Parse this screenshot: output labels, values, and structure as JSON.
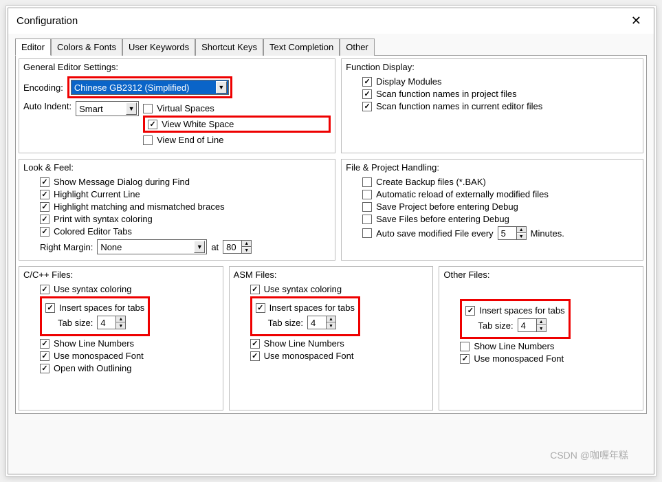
{
  "window": {
    "title": "Configuration",
    "close": "✕"
  },
  "tabs": [
    "Editor",
    "Colors & Fonts",
    "User Keywords",
    "Shortcut Keys",
    "Text Completion",
    "Other"
  ],
  "general": {
    "title": "General Editor Settings:",
    "encoding_label": "Encoding:",
    "encoding_value": "Chinese GB2312 (Simplified)",
    "auto_indent_label": "Auto Indent:",
    "auto_indent_value": "Smart",
    "virtual_spaces": "Virtual Spaces",
    "view_white_space": "View White Space",
    "view_eol": "View End of Line"
  },
  "function_display": {
    "title": "Function Display:",
    "display_modules": "Display Modules",
    "scan_project": "Scan function names in project files",
    "scan_editor": "Scan function names in current editor files"
  },
  "look_feel": {
    "title": "Look & Feel:",
    "show_msg": "Show Message Dialog during Find",
    "hl_line": "Highlight Current Line",
    "hl_brace": "Highlight matching and mismatched braces",
    "print_syntax": "Print with syntax coloring",
    "colored_tabs": "Colored Editor Tabs",
    "right_margin_label": "Right Margin:",
    "right_margin_value": "None",
    "at_label": "at",
    "at_value": "80"
  },
  "file_handling": {
    "title": "File & Project Handling:",
    "backup": "Create Backup files (*.BAK)",
    "auto_reload": "Automatic reload of externally modified files",
    "save_project": "Save Project before entering Debug",
    "save_files": "Save Files before entering Debug",
    "auto_save_label": "Auto save modified File every",
    "auto_save_value": "5",
    "minutes": "Minutes."
  },
  "ccpp": {
    "title": "C/C++ Files:",
    "syntax": "Use syntax coloring",
    "insert_spaces": "Insert spaces for tabs",
    "tab_size_label": "Tab size:",
    "tab_size_value": "4",
    "line_nums": "Show Line Numbers",
    "mono_font": "Use monospaced Font",
    "outlining": "Open with Outlining"
  },
  "asm": {
    "title": "ASM Files:",
    "syntax": "Use syntax coloring",
    "insert_spaces": "Insert spaces for tabs",
    "tab_size_label": "Tab size:",
    "tab_size_value": "4",
    "line_nums": "Show Line Numbers",
    "mono_font": "Use monospaced Font"
  },
  "other": {
    "title": "Other Files:",
    "insert_spaces": "Insert spaces for tabs",
    "tab_size_label": "Tab size:",
    "tab_size_value": "4",
    "line_nums": "Show Line Numbers",
    "mono_font": "Use monospaced Font"
  },
  "watermark": "CSDN @咖喱年糕"
}
